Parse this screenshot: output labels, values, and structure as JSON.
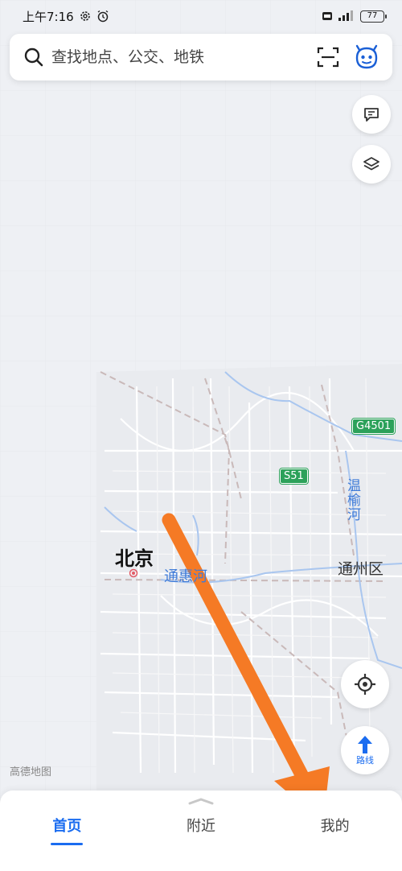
{
  "status_bar": {
    "time": "上午7:16",
    "battery": "77"
  },
  "search": {
    "placeholder": "查找地点、公交、地铁"
  },
  "map": {
    "city": "北京",
    "district": "通州区",
    "river_1": "通惠河",
    "river_2": "温榆河",
    "road_1": "G4501",
    "road_2": "S51",
    "watermark": "高德地图"
  },
  "controls": {
    "route_label": "路线"
  },
  "tabs": [
    {
      "label": "首页",
      "active": true
    },
    {
      "label": "附近",
      "active": false
    },
    {
      "label": "我的",
      "active": false
    }
  ],
  "colors": {
    "accent": "#1a6cf0",
    "annotation_arrow": "#f57a25",
    "road_badge": "#2ca15a"
  }
}
